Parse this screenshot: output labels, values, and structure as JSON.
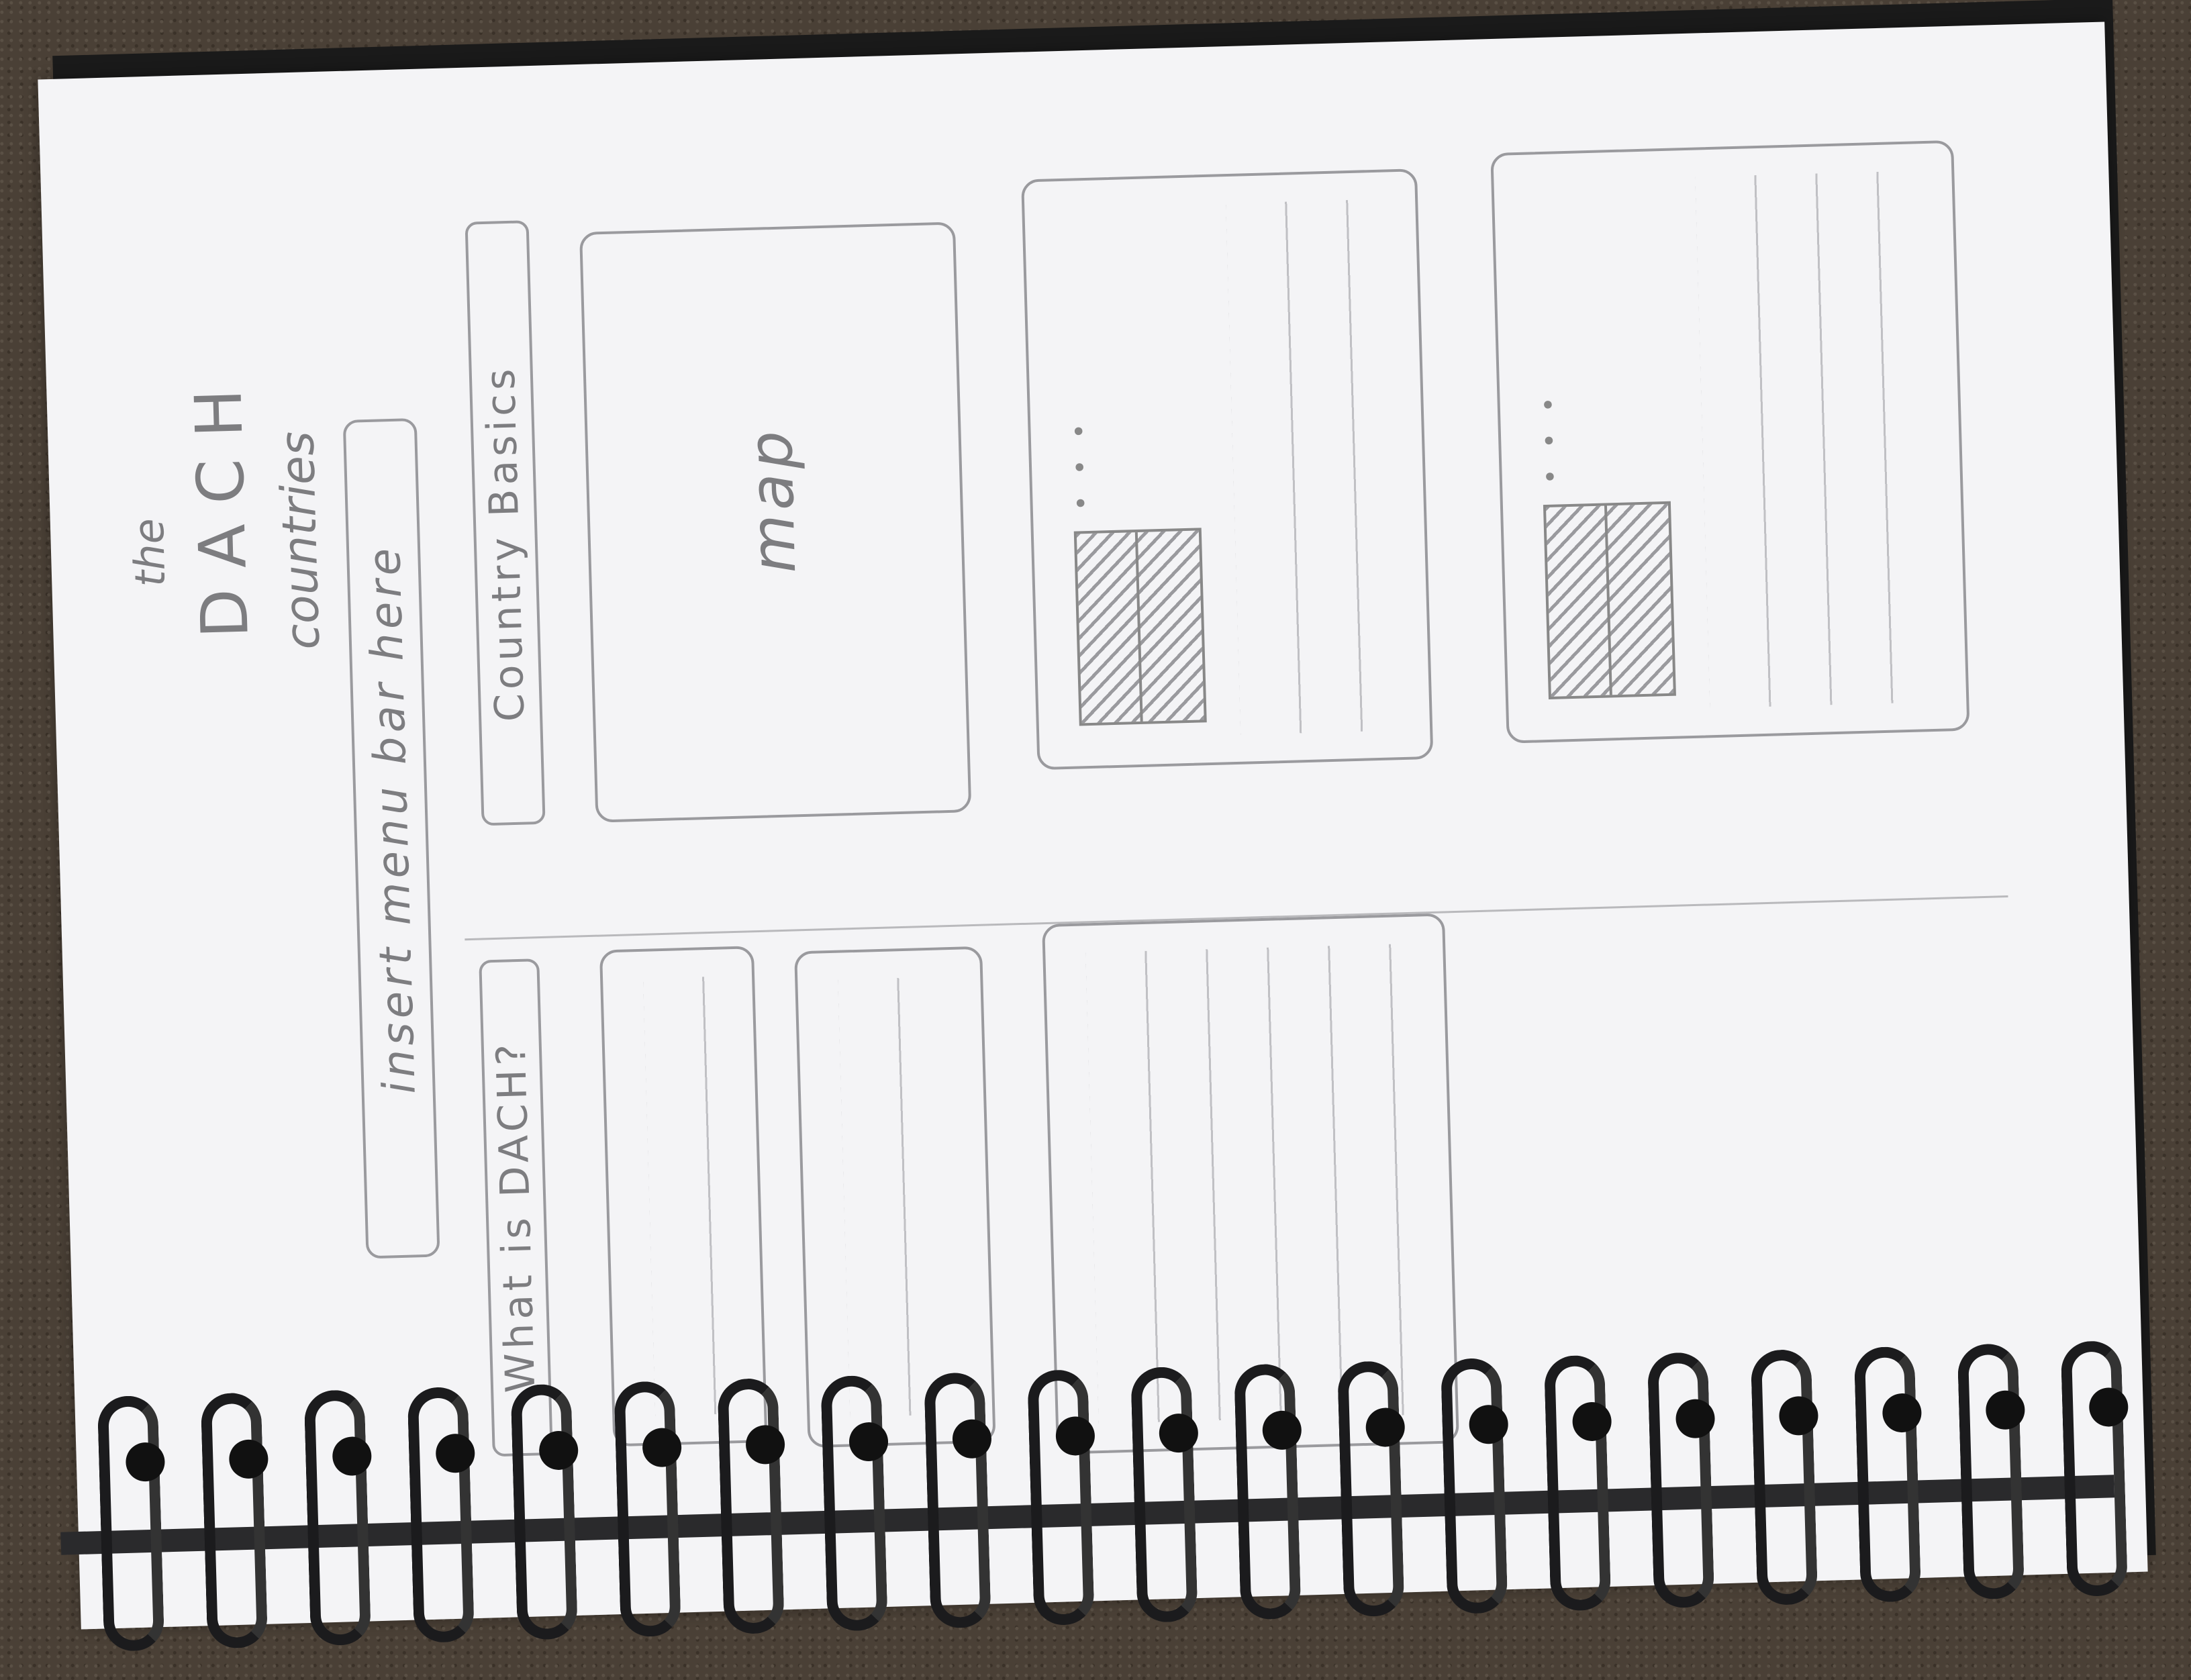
{
  "sketch": {
    "title_the": "the",
    "title_dach": "DACH",
    "title_countries": "countries",
    "menu_bar": "insert menu bar here",
    "section_what": "What is DACH?",
    "section_basics": "Country Basics",
    "map_label": "map"
  },
  "colors": {
    "pencil": "#7d7d80",
    "paper": "#f4f4f6",
    "desk": "#4a4036",
    "spiral": "#1b1b1d"
  },
  "icons": [
    "flag-placeholder-icon",
    "flag-placeholder-icon",
    "flag-placeholder-icon"
  ]
}
